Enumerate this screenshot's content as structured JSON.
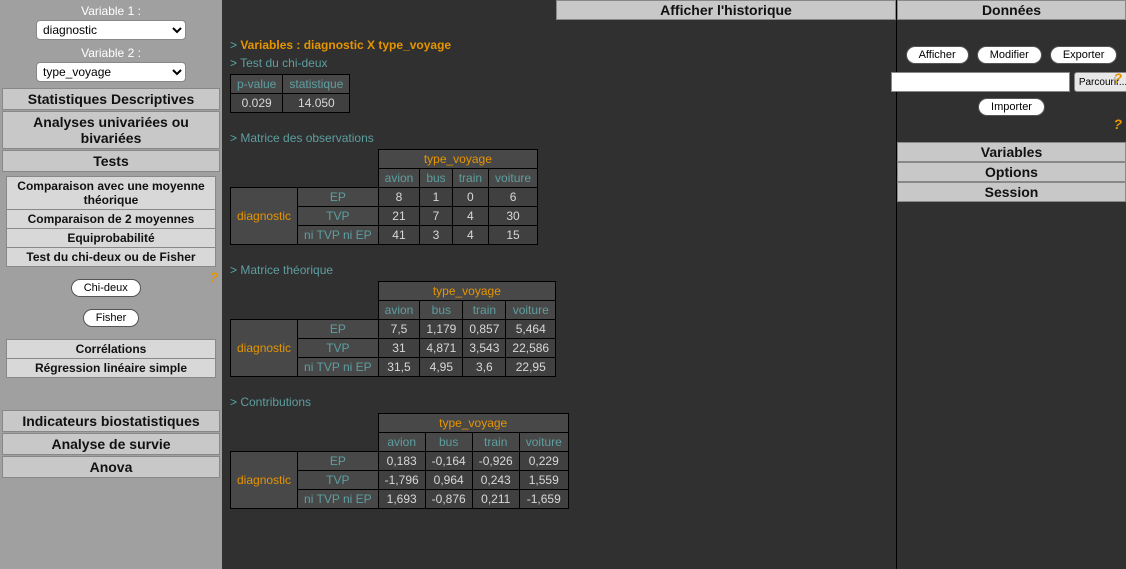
{
  "left": {
    "var1_label": "Variable 1 :",
    "var1_value": "diagnostic",
    "var2_label": "Variable 2 :",
    "var2_value": "type_voyage",
    "headers": {
      "stats_desc": "Statistiques Descriptives",
      "analyses": "Analyses univariées ou bivariées",
      "tests": "Tests",
      "indicateurs": "Indicateurs biostatistiques",
      "survie": "Analyse de survie",
      "anova": "Anova"
    },
    "tests_items": {
      "comp_moy_theo": "Comparaison avec une moyenne théorique",
      "comp_2_moy": "Comparaison de 2 moyennes",
      "equiprob": "Equiprobabilité",
      "chi2_fisher": "Test du chi-deux ou de Fisher"
    },
    "buttons": {
      "chi2": "Chi-deux",
      "fisher": "Fisher"
    },
    "corr_items": {
      "corr": "Corrélations",
      "reglin": "Régression linéaire simple"
    }
  },
  "content": {
    "variables_title": "Variables : diagnostic X type_voyage",
    "test_title": "Test du chi-deux",
    "chi2_table": {
      "h_pvalue": "p-value",
      "h_stat": "statistique",
      "pvalue": "0.029",
      "stat": "14.050"
    },
    "obs_title": "Matrice des observations",
    "theo_title": "Matrice théorique",
    "contrib_title": "Contributions",
    "col_var": "type_voyage",
    "row_var": "diagnostic",
    "cols": {
      "c1": "avion",
      "c2": "bus",
      "c3": "train",
      "c4": "voiture"
    },
    "rows": {
      "r1": "EP",
      "r2": "TVP",
      "r3": "ni TVP ni EP"
    },
    "obs": {
      "r1": {
        "c1": "8",
        "c2": "1",
        "c3": "0",
        "c4": "6"
      },
      "r2": {
        "c1": "21",
        "c2": "7",
        "c3": "4",
        "c4": "30"
      },
      "r3": {
        "c1": "41",
        "c2": "3",
        "c3": "4",
        "c4": "15"
      }
    },
    "theo": {
      "r1": {
        "c1": "7,5",
        "c2": "1,179",
        "c3": "0,857",
        "c4": "5,464"
      },
      "r2": {
        "c1": "31",
        "c2": "4,871",
        "c3": "3,543",
        "c4": "22,586"
      },
      "r3": {
        "c1": "31,5",
        "c2": "4,95",
        "c3": "3,6",
        "c4": "22,95"
      }
    },
    "contrib": {
      "r1": {
        "c1": "0,183",
        "c2": "-0,164",
        "c3": "-0,926",
        "c4": "0,229"
      },
      "r2": {
        "c1": "-1,796",
        "c2": "0,964",
        "c3": "0,243",
        "c4": "1,559"
      },
      "r3": {
        "c1": "1,693",
        "c2": "-0,876",
        "c3": "0,211",
        "c4": "-1,659"
      }
    }
  },
  "right": {
    "hist_title": "Afficher l'historique",
    "data_title": "Données",
    "btn_afficher": "Afficher",
    "btn_modifier": "Modifier",
    "btn_exporter": "Exporter",
    "btn_parcourir": "Parcourir...",
    "btn_importer": "Importer",
    "sect_variables": "Variables",
    "sect_options": "Options",
    "sect_session": "Session"
  }
}
